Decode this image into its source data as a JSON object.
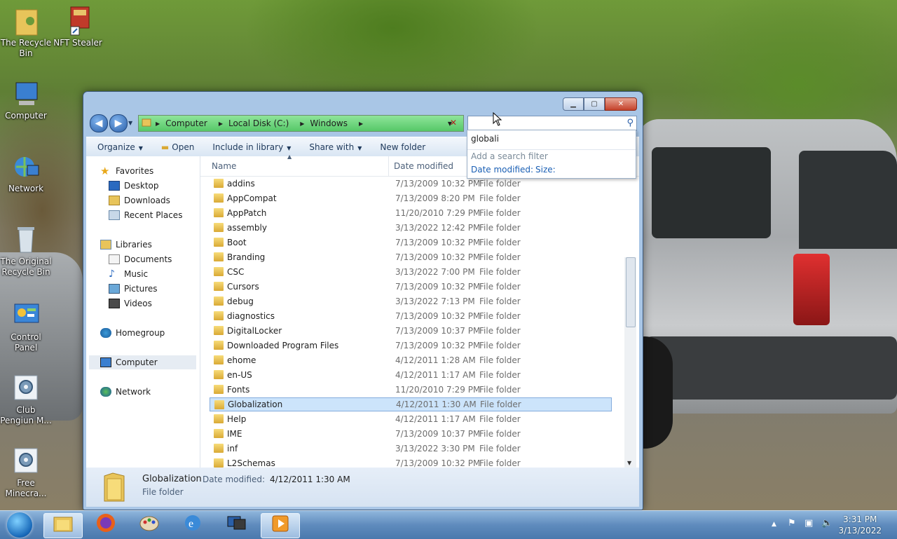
{
  "desktop": {
    "icons": [
      {
        "label": "The Recycle Bin",
        "icon": "folder-person-icon"
      },
      {
        "label": "NFT Stealer",
        "icon": "app-shortcut-icon"
      },
      {
        "label": "Computer",
        "icon": "computer-icon"
      },
      {
        "label": "Network",
        "icon": "network-icon"
      },
      {
        "label": "The Original Recycle Bin",
        "icon": "recycle-bin-icon"
      },
      {
        "label": "Control Panel",
        "icon": "control-panel-icon"
      },
      {
        "label": "Club Pengiun M...",
        "icon": "gears-shortcut-icon"
      },
      {
        "label": "Free Minecra...",
        "icon": "gears-shortcut-icon"
      }
    ]
  },
  "window": {
    "address": {
      "crumbs": [
        "Computer",
        "Local Disk (C:)",
        "Windows"
      ]
    },
    "search": {
      "value": ""
    },
    "toolbar": {
      "organize": "Organize",
      "open": "Open",
      "include": "Include in library",
      "share": "Share with",
      "new_folder": "New folder"
    },
    "nav": {
      "favorites": "Favorites",
      "desktop": "Desktop",
      "downloads": "Downloads",
      "recent": "Recent Places",
      "libraries": "Libraries",
      "documents": "Documents",
      "music": "Music",
      "pictures": "Pictures",
      "videos": "Videos",
      "homegroup": "Homegroup",
      "computer": "Computer",
      "network": "Network"
    },
    "columns": {
      "name": "Name",
      "date": "Date modified"
    },
    "files": [
      {
        "name": "addins",
        "date": "7/13/2009 10:32 PM",
        "type": "File folder"
      },
      {
        "name": "AppCompat",
        "date": "7/13/2009 8:20 PM",
        "type": "File folder"
      },
      {
        "name": "AppPatch",
        "date": "11/20/2010 7:29 PM",
        "type": "File folder"
      },
      {
        "name": "assembly",
        "date": "3/13/2022 12:42 PM",
        "type": "File folder"
      },
      {
        "name": "Boot",
        "date": "7/13/2009 10:32 PM",
        "type": "File folder"
      },
      {
        "name": "Branding",
        "date": "7/13/2009 10:32 PM",
        "type": "File folder"
      },
      {
        "name": "CSC",
        "date": "3/13/2022 7:00 PM",
        "type": "File folder"
      },
      {
        "name": "Cursors",
        "date": "7/13/2009 10:32 PM",
        "type": "File folder"
      },
      {
        "name": "debug",
        "date": "3/13/2022 7:13 PM",
        "type": "File folder"
      },
      {
        "name": "diagnostics",
        "date": "7/13/2009 10:32 PM",
        "type": "File folder"
      },
      {
        "name": "DigitalLocker",
        "date": "7/13/2009 10:37 PM",
        "type": "File folder"
      },
      {
        "name": "Downloaded Program Files",
        "date": "7/13/2009 10:32 PM",
        "type": "File folder"
      },
      {
        "name": "ehome",
        "date": "4/12/2011 1:28 AM",
        "type": "File folder"
      },
      {
        "name": "en-US",
        "date": "4/12/2011 1:17 AM",
        "type": "File folder"
      },
      {
        "name": "Fonts",
        "date": "11/20/2010 7:29 PM",
        "type": "File folder"
      },
      {
        "name": "Globalization",
        "date": "4/12/2011 1:30 AM",
        "type": "File folder"
      },
      {
        "name": "Help",
        "date": "4/12/2011 1:17 AM",
        "type": "File folder"
      },
      {
        "name": "IME",
        "date": "7/13/2009 10:37 PM",
        "type": "File folder"
      },
      {
        "name": "inf",
        "date": "3/13/2022 3:30 PM",
        "type": "File folder"
      },
      {
        "name": "L2Schemas",
        "date": "7/13/2009 10:32 PM",
        "type": "File folder"
      }
    ],
    "selected_index": 15,
    "details": {
      "name": "Globalization",
      "date_label": "Date modified:",
      "date_value": "4/12/2011 1:30 AM",
      "type": "File folder"
    }
  },
  "search_dropdown": {
    "suggestion": "globali",
    "add_filter": "Add a search filter",
    "filter_date": "Date modified:",
    "filter_size": "Size:"
  },
  "taskbar": {
    "clock_time": "3:31 PM",
    "clock_date": "3/13/2022"
  },
  "colors": {
    "address_bar": "#56c868",
    "selection": "#cce4fb",
    "link_blue": "#1a5fb4"
  }
}
